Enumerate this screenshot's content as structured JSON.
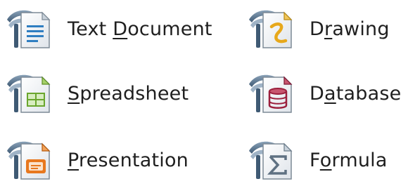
{
  "launcher": {
    "items": [
      {
        "id": "writer",
        "label": "Text Document",
        "mnemonic_index": 5,
        "icon": "text-document-icon",
        "accent_color": "#2f7ec1"
      },
      {
        "id": "draw",
        "label": "Drawing",
        "mnemonic_index": 1,
        "icon": "drawing-icon",
        "accent_color": "#e7a81b"
      },
      {
        "id": "calc",
        "label": "Spreadsheet",
        "mnemonic_index": 0,
        "icon": "spreadsheet-icon",
        "accent_color": "#6aa62e"
      },
      {
        "id": "base",
        "label": "Database",
        "mnemonic_index": 1,
        "icon": "database-icon",
        "accent_color": "#9b1f3c"
      },
      {
        "id": "impress",
        "label": "Presentation",
        "mnemonic_index": 0,
        "icon": "presentation-icon",
        "accent_color": "#e8781e"
      },
      {
        "id": "math",
        "label": "Formula",
        "mnemonic_index": 1,
        "icon": "formula-icon",
        "accent_color": "#6b7c8a"
      }
    ]
  }
}
